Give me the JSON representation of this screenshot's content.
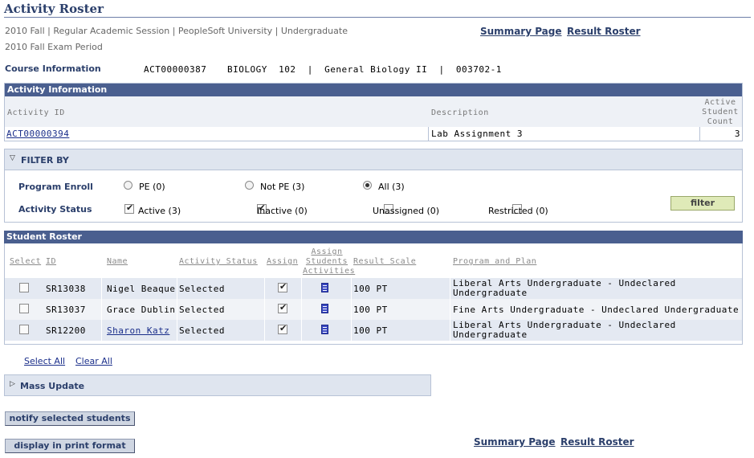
{
  "page": {
    "title": "Activity Roster",
    "term_line": "2010 Fall | Regular Academic Session | PeopleSoft University | Undergraduate",
    "exam_period": "2010 Fall Exam Period",
    "links": {
      "summary": "Summary Page",
      "result": "Result Roster"
    }
  },
  "course": {
    "label": "Course Information",
    "id": "ACT00000387",
    "details": "BIOLOGY  102  |  General Biology II  |  003702-1"
  },
  "activity": {
    "section_title": "Activity Information",
    "headers": {
      "id": "Activity ID",
      "description": "Description",
      "count": "Active Student Count"
    },
    "row": {
      "id": "ACT00000394",
      "description": "Lab Assignment 3",
      "count": "3"
    }
  },
  "filter": {
    "title": "FILTER BY",
    "program_label": "Program Enroll",
    "program_options": [
      {
        "label": "PE (0)",
        "selected": false
      },
      {
        "label": "Not PE (3)",
        "selected": false
      },
      {
        "label": "All (3)",
        "selected": true
      }
    ],
    "status_label": "Activity Status",
    "status_options": [
      {
        "label": "Active (3)",
        "checked": true
      },
      {
        "label": "Inactive (0)",
        "checked": true
      },
      {
        "label": "Unassigned (0)",
        "checked": false
      },
      {
        "label": "Restricted (0)",
        "checked": false
      }
    ],
    "button": "filter"
  },
  "roster": {
    "section_title": "Student Roster",
    "columns": {
      "select": "Select",
      "id": "ID",
      "name": "Name",
      "status": "Activity Status",
      "assign": "Assign",
      "assign_students": "Assign Students Activities",
      "result_scale": "Result Scale",
      "program": "Program and Plan"
    },
    "rows": [
      {
        "id": "SR13038",
        "name": "Nigel Beaque",
        "status": "Selected",
        "assigned": true,
        "scale": "100 PT",
        "program": "Liberal Arts Undergraduate - Undeclared Undergraduate",
        "selected": false
      },
      {
        "id": "SR13037",
        "name": "Grace Dublin",
        "status": "Selected",
        "assigned": true,
        "scale": "100 PT",
        "program": "Fine Arts Undergraduate - Undeclared Undergraduate",
        "selected": false
      },
      {
        "id": "SR12200",
        "name": "Sharon Katz",
        "status": "Selected",
        "assigned": true,
        "scale": "100 PT",
        "program": "Liberal Arts Undergraduate - Undeclared Undergraduate",
        "selected": false
      }
    ],
    "select_all": "Select All",
    "clear_all": "Clear All"
  },
  "mass_update": {
    "title": "Mass Update"
  },
  "buttons": {
    "notify": "notify selected students",
    "print": "display in print format"
  }
}
